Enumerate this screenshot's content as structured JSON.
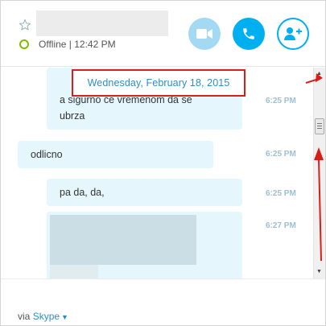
{
  "header": {
    "status": "Offline | 12:42 PM",
    "icons": {
      "star": "star-icon",
      "video": "video-camera-icon",
      "call": "phone-icon",
      "add": "add-person-icon"
    }
  },
  "conversation": {
    "date_separator": "Wednesday, February 18, 2015",
    "messages": [
      {
        "text_lines": [
          "a sigurno će vremenom da se",
          "ubrza"
        ],
        "time": "6:25 PM",
        "direction": "incoming"
      },
      {
        "text_lines": [
          "odlicno"
        ],
        "time": "6:25 PM",
        "direction": "outgoing"
      },
      {
        "text_lines": [
          "pa da, da,"
        ],
        "time": "6:25 PM",
        "direction": "incoming"
      },
      {
        "text_lines": [],
        "time": "6:27 PM",
        "direction": "incoming"
      }
    ]
  },
  "footer": {
    "via_label": "via",
    "via_link": "Skype"
  },
  "colors": {
    "accent": "#00aff0",
    "accent_soft": "#a3d9f3",
    "presence_offline_ring": "#7fba00",
    "bubble": "#e5f6fd",
    "annotation_red": "#d91e18",
    "date_text": "#2c8ec7",
    "time_text": "#9dbfd1"
  }
}
